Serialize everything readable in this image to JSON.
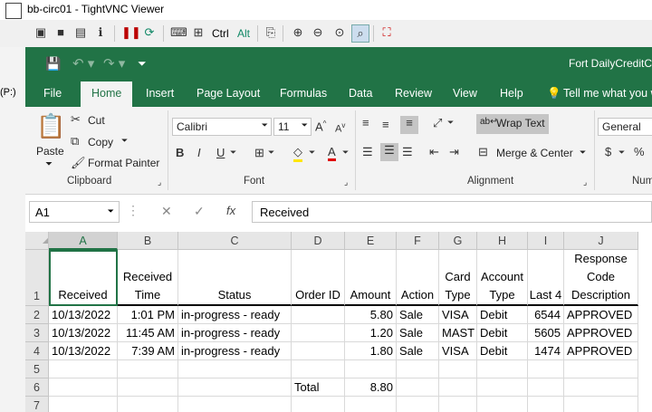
{
  "vnc": {
    "title": "bb-circ01 - TightVNC Viewer",
    "toolbar": {
      "ctrl_label": "Ctrl",
      "alt_label": "Alt"
    }
  },
  "background": {
    "drive_label": "(P:)"
  },
  "excel": {
    "filename": "Fort DailyCreditC",
    "tabs": [
      "File",
      "Home",
      "Insert",
      "Page Layout",
      "Formulas",
      "Data",
      "Review",
      "View",
      "Help"
    ],
    "active_tab": "Home",
    "tell_me": "Tell me what you w",
    "ribbon": {
      "clipboard": {
        "paste": "Paste",
        "cut": "Cut",
        "copy": "Copy",
        "format_painter": "Format Painter",
        "label": "Clipboard"
      },
      "font": {
        "name": "Calibri",
        "size": "11",
        "label": "Font"
      },
      "alignment": {
        "wrap_text": "Wrap Text",
        "merge_center": "Merge & Center",
        "label": "Alignment"
      },
      "number": {
        "format": "General",
        "label": "Num"
      }
    },
    "name_box": "A1",
    "formula": "Received",
    "columns": [
      "A",
      "B",
      "C",
      "D",
      "E",
      "F",
      "G",
      "H",
      "I",
      "J"
    ],
    "rows": [
      "1",
      "2",
      "3",
      "4",
      "5",
      "6",
      "7"
    ],
    "headers": [
      [
        "Received"
      ],
      [
        "Received",
        "Time"
      ],
      [
        "Status"
      ],
      [
        "Order ID"
      ],
      [
        "Amount"
      ],
      [
        "Action"
      ],
      [
        "Card",
        "Type"
      ],
      [
        "Account",
        "Type"
      ],
      [
        "Last 4"
      ],
      [
        "Response",
        "Code",
        "Description"
      ]
    ],
    "data": [
      [
        "10/13/2022",
        "1:01 PM",
        "in-progress - ready",
        "",
        "5.80",
        "Sale",
        "VISA",
        "Debit",
        "6544",
        "APPROVED"
      ],
      [
        "10/13/2022",
        "11:45 AM",
        "in-progress - ready",
        "",
        "1.20",
        "Sale",
        "MAST",
        "Debit",
        "5605",
        "APPROVED"
      ],
      [
        "10/13/2022",
        "7:39 AM",
        "in-progress - ready",
        "",
        "1.80",
        "Sale",
        "VISA",
        "Debit",
        "1474",
        "APPROVED"
      ],
      [
        "",
        "",
        "",
        "",
        "",
        "",
        "",
        "",
        "",
        ""
      ],
      [
        "",
        "",
        "",
        "Total",
        "8.80",
        "",
        "",
        "",
        "",
        ""
      ],
      [
        "",
        "",
        "",
        "",
        "",
        "",
        "",
        "",
        "",
        ""
      ]
    ]
  }
}
